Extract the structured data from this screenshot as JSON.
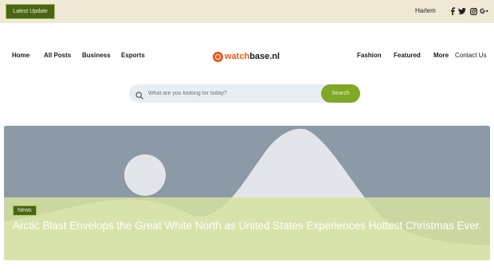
{
  "topbar": {
    "latest_label": "Latest Update",
    "city": "Harlem",
    "social_icons": [
      "facebook-icon",
      "twitter-icon",
      "instagram-icon",
      "google-plus-icon"
    ]
  },
  "nav": {
    "left": [
      "Home",
      "All Posts",
      "Business",
      "Esports"
    ],
    "right": [
      "Fashion",
      "Featured",
      "More",
      "Contact Us"
    ]
  },
  "logo": {
    "part1": "watch",
    "part2": "base.nl"
  },
  "search": {
    "placeholder": "What are you looking for today?",
    "button_label": "Search"
  },
  "hero": {
    "category": "News",
    "headline": "Arctic Blast Envelops the Great White North as United States Experiences Hottest Christmas Ever."
  },
  "colors": {
    "accent": "#7fa825",
    "accent_dark": "#4a6418",
    "topbar_bg": "#efe9d6",
    "brand_orange": "#e85a1a"
  }
}
